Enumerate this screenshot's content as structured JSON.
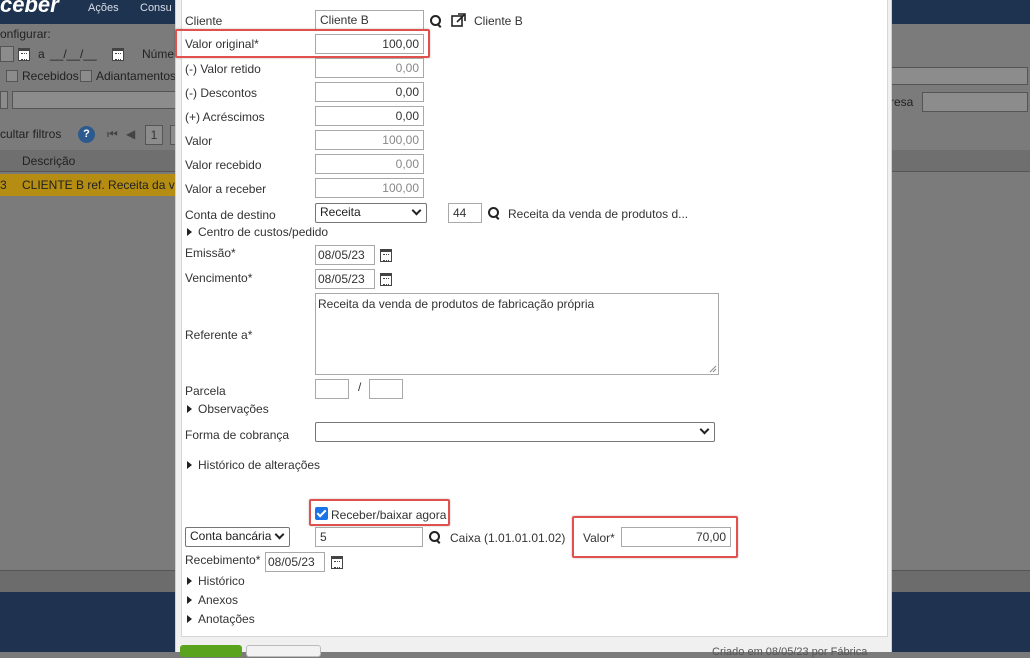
{
  "background": {
    "brand": "ceber",
    "menu": [
      "Ações",
      "Consu"
    ],
    "configurar": "onfigurar:",
    "date_sep": "a",
    "date_placeholder": "__/__/__",
    "numero_label": "Núme",
    "checkboxes": [
      "Recebidos",
      "Adiantamentos"
    ],
    "filter_button": "cultar filtros",
    "page": "1",
    "empresa_label": "resa",
    "table_header": "Descrição",
    "row_text": "CLIENTE B ref. Receita da ve",
    "row_num": "3"
  },
  "form": {
    "cliente": {
      "label": "Cliente",
      "value": "Cliente B",
      "link_text": "Cliente B"
    },
    "valor_original": {
      "label": "Valor original*",
      "value": "100,00"
    },
    "valor_retido": {
      "label": "(-) Valor retido",
      "value": "0,00"
    },
    "descontos": {
      "label": "(-) Descontos",
      "value": "0,00"
    },
    "acrescimos": {
      "label": "(+) Acréscimos",
      "value": "0,00"
    },
    "valor": {
      "label": "Valor",
      "value": "100,00"
    },
    "valor_recebido": {
      "label": "Valor recebido",
      "value": "0,00"
    },
    "valor_a_receber": {
      "label": "Valor a receber",
      "value": "100,00"
    },
    "conta_destino": {
      "label": "Conta de destino",
      "select": "Receita",
      "code": "44",
      "description": "Receita da venda de produtos d..."
    },
    "centro_custos": "Centro de custos/pedido",
    "emissao": {
      "label": "Emissão*",
      "value": "08/05/23"
    },
    "vencimento": {
      "label": "Vencimento*",
      "value": "08/05/23"
    },
    "referente": {
      "label": "Referente a*",
      "value": "Receita da venda de produtos de fabricação própria"
    },
    "parcela": {
      "label": "Parcela",
      "sep": "/"
    },
    "observacoes": "Observações",
    "forma_cobranca": {
      "label": "Forma de cobrança",
      "value": ""
    },
    "historico_alteracoes": "Histórico de alterações",
    "receber_agora": {
      "label": "Receber/baixar agora",
      "checked": true
    },
    "conta_bancaria": {
      "select": "Conta bancária",
      "code": "5",
      "description": "Caixa (1.01.01.01.02)"
    },
    "valor_baixa": {
      "label": "Valor*",
      "value": "70,00"
    },
    "recebimento": {
      "label": "Recebimento*",
      "value": "08/05/23"
    },
    "historico": "Histórico",
    "anexos": "Anexos",
    "anotacoes": "Anotações"
  },
  "footer": {
    "created": "Criado em 08/05/23 por Fábrica"
  },
  "colors": {
    "highlight": "#e0504d",
    "checkbox": "#1a73e8",
    "header_bg": "#1e3350",
    "row_selected": "#b58d12",
    "save_button": "#5aa31c"
  }
}
